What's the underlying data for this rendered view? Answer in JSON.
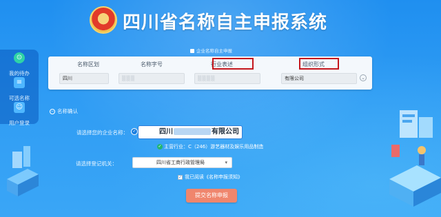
{
  "header": {
    "title": "四川省名称自主申报系统"
  },
  "sidenav": {
    "items": [
      {
        "label": "我的待办",
        "icon": "clipboard-icon"
      },
      {
        "label": "可选名称",
        "icon": "document-icon"
      },
      {
        "label": "用户登录",
        "icon": "user-icon"
      }
    ]
  },
  "step": {
    "label": "企业名称自主申报"
  },
  "form": {
    "columns": [
      {
        "header": "名称区划",
        "value": "四川"
      },
      {
        "header": "名称字号",
        "value": ""
      },
      {
        "header": "行业表述",
        "value": ""
      },
      {
        "header": "组织形式",
        "value": "有限公司"
      }
    ]
  },
  "confirm": {
    "section_title": "名称确认",
    "company_label": "请选择您的企业名称：",
    "company_name_prefix": "四川",
    "company_name_suffix": "有限公司",
    "industry_text": "主营行业：C（246）游艺器材及娱乐用品制造",
    "authority_label": "请选择登记机关：",
    "authority_value": "四川省工商行政管理局",
    "agree_text": "我已阅读《名称申报须知》",
    "submit_label": "提交名称申报"
  },
  "colors": {
    "background": "#2f9cf4",
    "highlight_border": "#c4161c",
    "submit_button": "#f0866d"
  }
}
